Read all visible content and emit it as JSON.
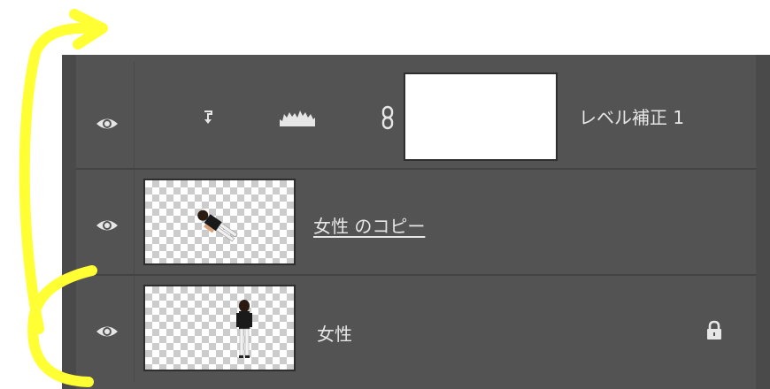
{
  "colors": {
    "panel_bg": "#535353",
    "text": "#e6e6e6",
    "annotation": "#ffff33"
  },
  "layers": [
    {
      "name": "レベル補正 1",
      "type": "adjustment",
      "visible": true,
      "clipped": true,
      "adjustment_icon": "levels-histogram-icon",
      "linked": true
    },
    {
      "name": "女性 のコピー",
      "type": "pixel",
      "visible": true,
      "underlined": true
    },
    {
      "name": "女性",
      "type": "pixel",
      "visible": true,
      "locked": true
    }
  ],
  "annotation": {
    "shape": "yellow-curved-arrow"
  }
}
